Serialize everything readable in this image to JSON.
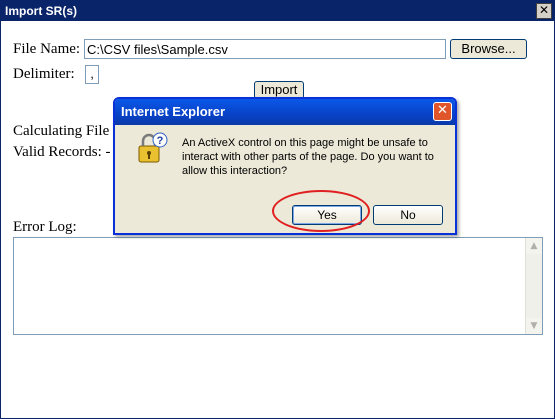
{
  "window": {
    "title": "Import SR(s)",
    "close_glyph": "✕"
  },
  "form": {
    "file_label": "File Name:",
    "file_value": "C:\\CSV files\\Sample.csv",
    "browse_label": "Browse...",
    "delimiter_label": "Delimiter:",
    "delimiter_value": ",",
    "import_label": "Import",
    "calc_label": "Calculating File S",
    "valid_label": "Valid Records: -",
    "error_log_label": "Error Log:"
  },
  "dialog": {
    "title": "Internet Explorer",
    "close_glyph": "✕",
    "message": "An ActiveX control on this page might be unsafe to interact with other parts of the page. Do you want to allow this interaction?",
    "yes_label": "Yes",
    "no_label": "No",
    "icon": "key-lock-question-icon"
  },
  "scrollbar": {
    "up_glyph": "▲",
    "down_glyph": "▼"
  },
  "colors": {
    "title_bar": "#0a246a",
    "dialog_title": "#0842c8",
    "highlight_circle": "#e02020"
  }
}
